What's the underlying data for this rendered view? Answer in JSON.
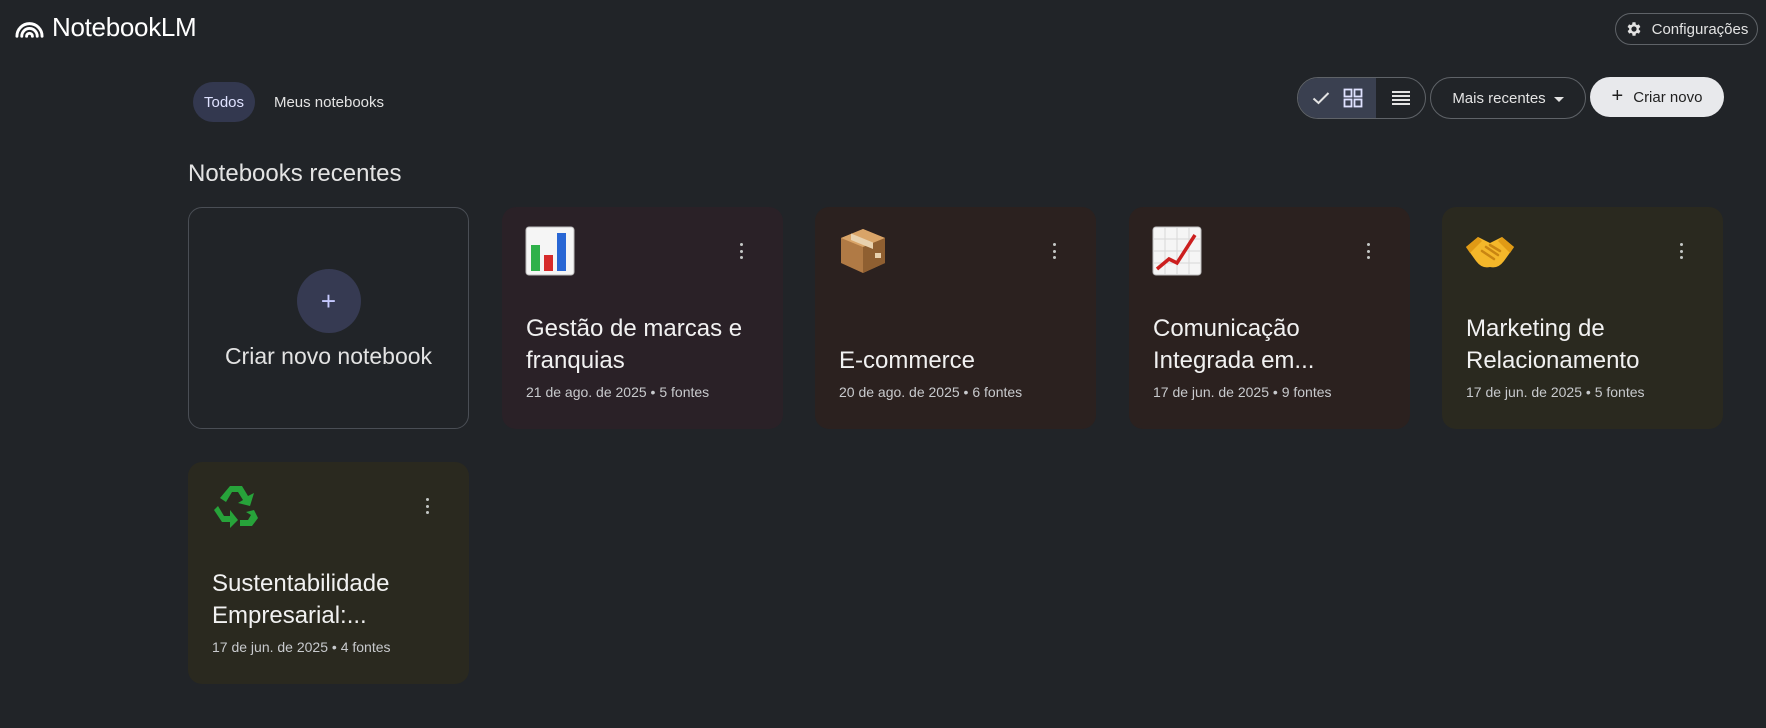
{
  "app": {
    "name": "NotebookLM",
    "settings_label": "Configurações"
  },
  "filters": {
    "tabs": [
      {
        "label": "Todos",
        "selected": true
      },
      {
        "label": "Meus notebooks",
        "selected": false
      }
    ]
  },
  "toolbar": {
    "view_mode": "grid",
    "sort_label": "Mais recentes",
    "create_label": "Criar novo"
  },
  "section": {
    "title": "Notebooks recentes"
  },
  "new_notebook": {
    "label": "Criar novo notebook",
    "icon": "+"
  },
  "notebooks": [
    {
      "icon": "bar-chart-icon",
      "title": "Gestão de marcas e franquias",
      "date": "21 de ago. de 2025",
      "sources": "5 fontes",
      "bg": "#2a2127"
    },
    {
      "icon": "package-icon",
      "title": "E-commerce",
      "date": "20 de ago. de 2025",
      "sources": "6 fontes",
      "bg": "#2b211f"
    },
    {
      "icon": "chart-increasing-icon",
      "title": "Comunicação Integrada em...",
      "date": "17 de jun. de 2025",
      "sources": "9 fontes",
      "bg": "#2b211f"
    },
    {
      "icon": "handshake-icon",
      "title": "Marketing de Relacionamento",
      "date": "17 de jun. de 2025",
      "sources": "5 fontes",
      "bg": "#2a291f"
    },
    {
      "icon": "recycle-icon",
      "title": "Sustentabilidade Empresarial:...",
      "date": "17 de jun. de 2025",
      "sources": "4 fontes",
      "bg": "#2a291f"
    }
  ],
  "meta_separator": " • "
}
